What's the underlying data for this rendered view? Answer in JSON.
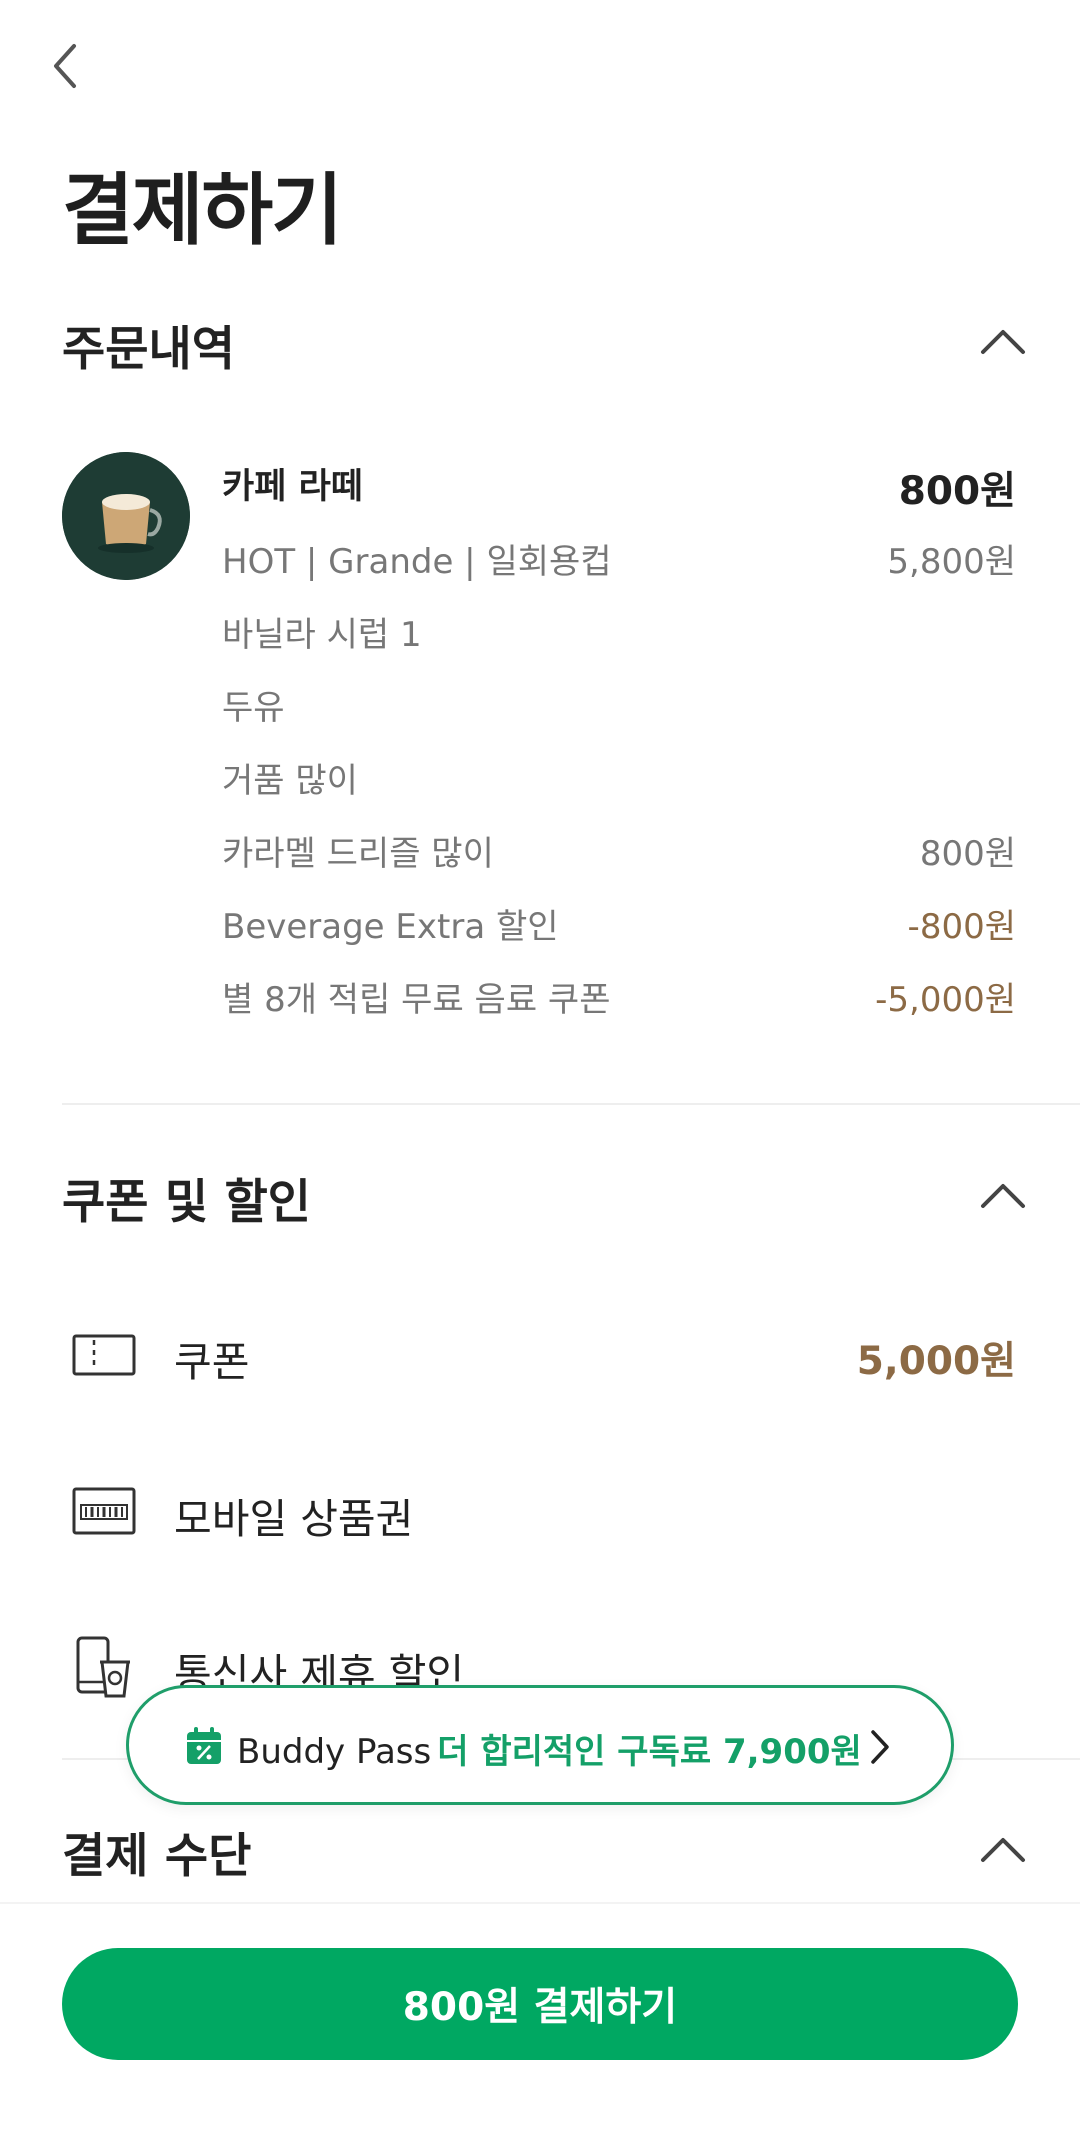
{
  "header": {
    "title": "결제하기"
  },
  "order": {
    "section_title": "주문내역",
    "item": {
      "name": "카페 라떼",
      "price": "800원",
      "options": [
        {
          "label": "HOT | Grande | 일회용컵",
          "price": "5,800원",
          "type": "normal"
        },
        {
          "label": "바닐라 시럽 1",
          "price": "",
          "type": "normal"
        },
        {
          "label": "두유",
          "price": "",
          "type": "normal"
        },
        {
          "label": "거품 많이",
          "price": "",
          "type": "normal"
        },
        {
          "label": "카라멜 드리즐 많이",
          "price": "800원",
          "type": "normal"
        },
        {
          "label": "Beverage Extra 할인",
          "price": "-800원",
          "type": "discount"
        },
        {
          "label": "별 8개 적립 무료 음료 쿠폰",
          "price": "-5,000원",
          "type": "discount"
        }
      ]
    }
  },
  "discounts": {
    "section_title": "쿠폰 및 할인",
    "items": [
      {
        "label": "쿠폰",
        "value": "5,000원",
        "icon": "ticket-icon"
      },
      {
        "label": "모바일 상품권",
        "value": "",
        "icon": "gift-card-icon"
      },
      {
        "label": "통신사 제휴 할인",
        "value": "",
        "icon": "carrier-phone-icon"
      }
    ]
  },
  "buddy_pass": {
    "name": "Buddy Pass",
    "promo": "더 합리적인 구독료 7,900원"
  },
  "payment": {
    "section_title": "결제 수단"
  },
  "pay_button": {
    "label": "800원 결제하기"
  },
  "colors": {
    "brand_green": "#00a862",
    "promo_green": "#14a068",
    "discount_brown": "#8c6a45",
    "thumb_bg": "#1e3c34"
  }
}
